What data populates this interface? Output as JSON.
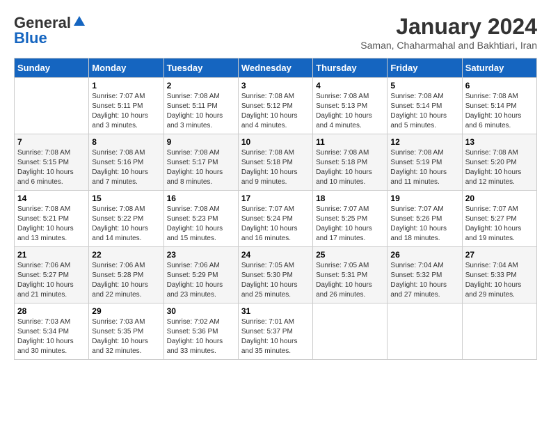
{
  "header": {
    "logo_line1": "General",
    "logo_line2": "Blue",
    "month": "January 2024",
    "subtitle": "Saman, Chaharmahal and Bakhtiari, Iran"
  },
  "days_of_week": [
    "Sunday",
    "Monday",
    "Tuesday",
    "Wednesday",
    "Thursday",
    "Friday",
    "Saturday"
  ],
  "weeks": [
    [
      {
        "day": "",
        "sunrise": "",
        "sunset": "",
        "daylight": ""
      },
      {
        "day": "1",
        "sunrise": "7:07 AM",
        "sunset": "5:11 PM",
        "daylight": "10 hours and 3 minutes."
      },
      {
        "day": "2",
        "sunrise": "7:08 AM",
        "sunset": "5:11 PM",
        "daylight": "10 hours and 3 minutes."
      },
      {
        "day": "3",
        "sunrise": "7:08 AM",
        "sunset": "5:12 PM",
        "daylight": "10 hours and 4 minutes."
      },
      {
        "day": "4",
        "sunrise": "7:08 AM",
        "sunset": "5:13 PM",
        "daylight": "10 hours and 4 minutes."
      },
      {
        "day": "5",
        "sunrise": "7:08 AM",
        "sunset": "5:14 PM",
        "daylight": "10 hours and 5 minutes."
      },
      {
        "day": "6",
        "sunrise": "7:08 AM",
        "sunset": "5:14 PM",
        "daylight": "10 hours and 6 minutes."
      }
    ],
    [
      {
        "day": "7",
        "sunrise": "7:08 AM",
        "sunset": "5:15 PM",
        "daylight": "10 hours and 6 minutes."
      },
      {
        "day": "8",
        "sunrise": "7:08 AM",
        "sunset": "5:16 PM",
        "daylight": "10 hours and 7 minutes."
      },
      {
        "day": "9",
        "sunrise": "7:08 AM",
        "sunset": "5:17 PM",
        "daylight": "10 hours and 8 minutes."
      },
      {
        "day": "10",
        "sunrise": "7:08 AM",
        "sunset": "5:18 PM",
        "daylight": "10 hours and 9 minutes."
      },
      {
        "day": "11",
        "sunrise": "7:08 AM",
        "sunset": "5:18 PM",
        "daylight": "10 hours and 10 minutes."
      },
      {
        "day": "12",
        "sunrise": "7:08 AM",
        "sunset": "5:19 PM",
        "daylight": "10 hours and 11 minutes."
      },
      {
        "day": "13",
        "sunrise": "7:08 AM",
        "sunset": "5:20 PM",
        "daylight": "10 hours and 12 minutes."
      }
    ],
    [
      {
        "day": "14",
        "sunrise": "7:08 AM",
        "sunset": "5:21 PM",
        "daylight": "10 hours and 13 minutes."
      },
      {
        "day": "15",
        "sunrise": "7:08 AM",
        "sunset": "5:22 PM",
        "daylight": "10 hours and 14 minutes."
      },
      {
        "day": "16",
        "sunrise": "7:08 AM",
        "sunset": "5:23 PM",
        "daylight": "10 hours and 15 minutes."
      },
      {
        "day": "17",
        "sunrise": "7:07 AM",
        "sunset": "5:24 PM",
        "daylight": "10 hours and 16 minutes."
      },
      {
        "day": "18",
        "sunrise": "7:07 AM",
        "sunset": "5:25 PM",
        "daylight": "10 hours and 17 minutes."
      },
      {
        "day": "19",
        "sunrise": "7:07 AM",
        "sunset": "5:26 PM",
        "daylight": "10 hours and 18 minutes."
      },
      {
        "day": "20",
        "sunrise": "7:07 AM",
        "sunset": "5:27 PM",
        "daylight": "10 hours and 19 minutes."
      }
    ],
    [
      {
        "day": "21",
        "sunrise": "7:06 AM",
        "sunset": "5:27 PM",
        "daylight": "10 hours and 21 minutes."
      },
      {
        "day": "22",
        "sunrise": "7:06 AM",
        "sunset": "5:28 PM",
        "daylight": "10 hours and 22 minutes."
      },
      {
        "day": "23",
        "sunrise": "7:06 AM",
        "sunset": "5:29 PM",
        "daylight": "10 hours and 23 minutes."
      },
      {
        "day": "24",
        "sunrise": "7:05 AM",
        "sunset": "5:30 PM",
        "daylight": "10 hours and 25 minutes."
      },
      {
        "day": "25",
        "sunrise": "7:05 AM",
        "sunset": "5:31 PM",
        "daylight": "10 hours and 26 minutes."
      },
      {
        "day": "26",
        "sunrise": "7:04 AM",
        "sunset": "5:32 PM",
        "daylight": "10 hours and 27 minutes."
      },
      {
        "day": "27",
        "sunrise": "7:04 AM",
        "sunset": "5:33 PM",
        "daylight": "10 hours and 29 minutes."
      }
    ],
    [
      {
        "day": "28",
        "sunrise": "7:03 AM",
        "sunset": "5:34 PM",
        "daylight": "10 hours and 30 minutes."
      },
      {
        "day": "29",
        "sunrise": "7:03 AM",
        "sunset": "5:35 PM",
        "daylight": "10 hours and 32 minutes."
      },
      {
        "day": "30",
        "sunrise": "7:02 AM",
        "sunset": "5:36 PM",
        "daylight": "10 hours and 33 minutes."
      },
      {
        "day": "31",
        "sunrise": "7:01 AM",
        "sunset": "5:37 PM",
        "daylight": "10 hours and 35 minutes."
      },
      {
        "day": "",
        "sunrise": "",
        "sunset": "",
        "daylight": ""
      },
      {
        "day": "",
        "sunrise": "",
        "sunset": "",
        "daylight": ""
      },
      {
        "day": "",
        "sunrise": "",
        "sunset": "",
        "daylight": ""
      }
    ]
  ]
}
